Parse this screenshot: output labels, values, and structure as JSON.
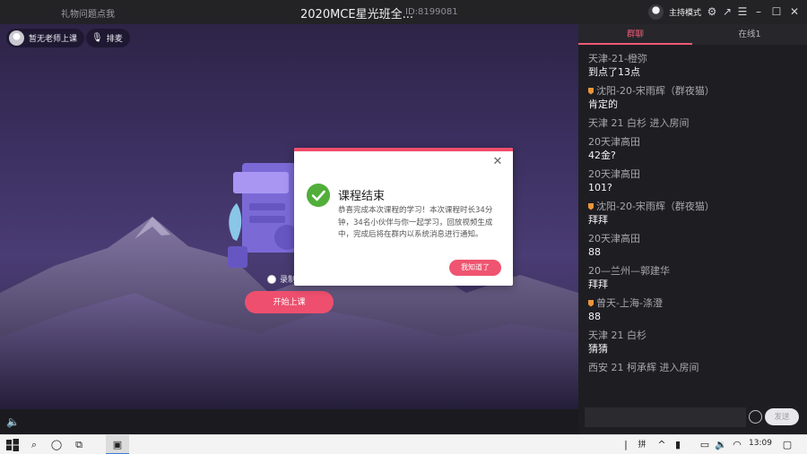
{
  "titlebar": {
    "left_text": "礼物问题点我",
    "title": "2020MCE星光班全...",
    "room_id": "ID:8199081",
    "host_mode_label": "主持模式",
    "icons": [
      "settings-icon",
      "share-icon",
      "menu-icon",
      "minimize-icon",
      "maximize-icon",
      "close-icon"
    ]
  },
  "classroom": {
    "teacher_status": "暂无老师上课",
    "queue_label": "排麦",
    "radio_label": "录制",
    "start_button": "开始上课"
  },
  "dialog": {
    "title": "课程结束",
    "body": "恭喜完成本次课程的学习！本次课程时长34分钟，34名小伙伴与你一起学习，回放视频生成中，完成后将在群内以系统消息进行通知。",
    "ok_button": "我知道了",
    "accent": "#f04d6d",
    "success": "#52ae3a"
  },
  "chat": {
    "tabs": [
      {
        "label": "群聊"
      },
      {
        "label": "在线1"
      }
    ],
    "messages": [
      {
        "name": "天津-21-橙弥",
        "text": "到点了13点"
      },
      {
        "name": "沈阳-20-宋雨辉（群夜猫）",
        "text": "肯定的",
        "badge": true
      },
      {
        "name": "天津 21 白杉  进入房间",
        "text": ""
      },
      {
        "name": "20天津高田",
        "text": "42金?"
      },
      {
        "name": "20天津高田",
        "text": "101?"
      },
      {
        "name": "沈阳-20-宋雨辉（群夜猫）",
        "text": "拜拜",
        "badge": true
      },
      {
        "name": "20天津高田",
        "text": "88"
      },
      {
        "name": "20—兰州—郭建华",
        "text": "拜拜"
      },
      {
        "name": "曾天-上海-涤澄",
        "text": "88",
        "badge": true
      },
      {
        "name": "天津 21 白杉",
        "text": "猜猜"
      },
      {
        "name": "西安 21 柯承辉  进入房间",
        "text": ""
      }
    ],
    "input_placeholder": "",
    "send_button": "发送"
  },
  "taskbar": {
    "time": "13:09",
    "ime": "拼"
  }
}
